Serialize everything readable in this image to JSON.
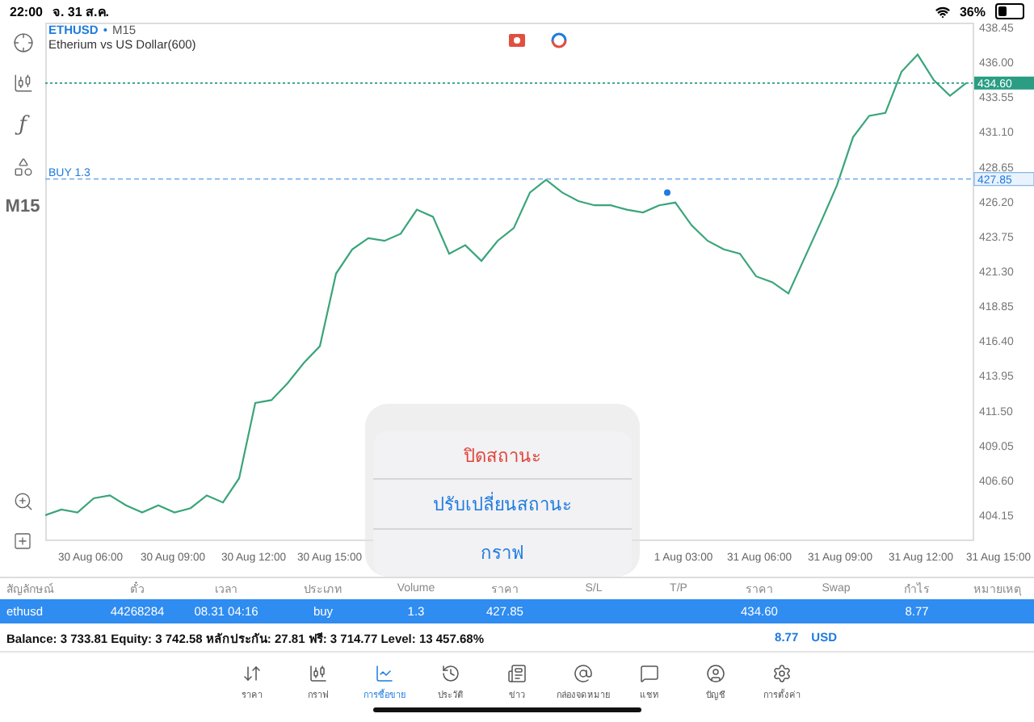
{
  "status_bar": {
    "time": "22:00",
    "date": "จ. 31 ส.ค.",
    "battery": "36%"
  },
  "left_toolbar": {
    "indicator": "ƒ",
    "timeframe": "M15"
  },
  "chart": {
    "symbol": "ETHUSD",
    "separator": "•",
    "timeframe": "M15",
    "subtitle": "Etherium vs US Dollar(600)",
    "order_label": "BUY 1.3",
    "chart_data": {
      "type": "line",
      "series": [
        {
          "color": "#3aa57a",
          "values": [
            404.2,
            404.6,
            404.4,
            405.4,
            405.6,
            404.9,
            404.4,
            404.9,
            404.4,
            404.7,
            405.6,
            405.1,
            406.8,
            412.1,
            412.3,
            413.5,
            414.9,
            416.1,
            421.2,
            422.9,
            423.7,
            423.5,
            424.0,
            425.7,
            425.2,
            422.6,
            423.2,
            422.1,
            423.5,
            424.4,
            426.9,
            427.8,
            426.9,
            426.3,
            426.0,
            426.0,
            425.7,
            425.5,
            426.0,
            426.2,
            424.6,
            423.5,
            422.9,
            422.6,
            421.0,
            420.6,
            419.8,
            422.3,
            424.8,
            427.4,
            430.8,
            432.3,
            432.5,
            435.4,
            436.6,
            434.8,
            433.7,
            434.6
          ]
        }
      ],
      "ylim": [
        402.5,
        438.85
      ],
      "yticks": [
        {
          "value": 438.45,
          "label": "438.45"
        },
        {
          "value": 436.0,
          "label": "436.00"
        },
        {
          "value": 433.55,
          "label": "433.55"
        },
        {
          "value": 431.1,
          "label": "431.10"
        },
        {
          "value": 428.65,
          "label": "428.65"
        },
        {
          "value": 426.2,
          "label": "426.20"
        },
        {
          "value": 423.75,
          "label": "423.75"
        },
        {
          "value": 421.3,
          "label": "421.30"
        },
        {
          "value": 418.85,
          "label": "418.85"
        },
        {
          "value": 416.4,
          "label": "416.40"
        },
        {
          "value": 413.95,
          "label": "413.95"
        },
        {
          "value": 411.5,
          "label": "411.50"
        },
        {
          "value": 409.05,
          "label": "409.05"
        },
        {
          "value": 406.6,
          "label": "406.60"
        },
        {
          "value": 404.15,
          "label": "404.15"
        }
      ]
    },
    "price_lines": [
      {
        "label": "434.60",
        "kind": "current"
      },
      {
        "label": "427.85",
        "kind": "order"
      }
    ],
    "time_labels": [
      "30 Aug 06:00",
      "30 Aug 09:00",
      "30 Aug 12:00",
      "30 Aug 15:00",
      "1 Aug 03:00",
      "31 Aug 06:00",
      "31 Aug 09:00",
      "31 Aug 12:00",
      "31 Aug 15:00"
    ]
  },
  "action_sheet": {
    "items": [
      {
        "label": "ปิดสถานะ",
        "kind": "destructive"
      },
      {
        "label": "ปรับเปลี่ยนสถานะ",
        "kind": "default"
      },
      {
        "label": "กราฟ",
        "kind": "default"
      }
    ]
  },
  "positions": {
    "columns": [
      "สัญลักษณ์",
      "ตั๋ว",
      "เวลา",
      "ประเภท",
      "Volume",
      "ราคา",
      "S/L",
      "T/P",
      "ราคา",
      "Swap",
      "กำไร",
      "หมายเหตุ"
    ],
    "rows": [
      {
        "selected": true,
        "cells": [
          {
            "kind": "value",
            "text": "ethusd"
          },
          {
            "kind": "value",
            "text": "44268284"
          },
          {
            "kind": "value",
            "text": "08.31 04:16"
          },
          {
            "kind": "value",
            "text": "buy"
          },
          {
            "kind": "value",
            "text": "1.3"
          },
          {
            "kind": "value",
            "text": "427.85"
          },
          {
            "kind": "empty"
          },
          {
            "kind": "empty"
          },
          {
            "kind": "value",
            "text": "434.60"
          },
          {
            "kind": "empty"
          },
          {
            "kind": "value",
            "text": "8.77"
          },
          {
            "kind": "empty"
          }
        ]
      }
    ]
  },
  "summary": {
    "text": "Balance: 3 733.81 Equity: 3 742.58 หลักประกัน: 27.81 ฟรี: 3 714.77 Level: 13 457.68%",
    "profit": "8.77",
    "currency": "USD"
  },
  "tab_bar": [
    {
      "label": "ราคา",
      "kind": "quotes",
      "selected": false
    },
    {
      "label": "กราฟ",
      "kind": "chart",
      "selected": false
    },
    {
      "label": "การซื้อขาย",
      "kind": "trade",
      "selected": true
    },
    {
      "label": "ประวัติ",
      "kind": "history",
      "selected": false
    },
    {
      "label": "ข่าว",
      "kind": "news",
      "selected": false
    },
    {
      "label": "กล่องจดหมาย",
      "kind": "mail",
      "selected": false
    },
    {
      "label": "แชท",
      "kind": "chat",
      "selected": false
    },
    {
      "label": "บัญชี",
      "kind": "account",
      "selected": false
    },
    {
      "label": "การตั้งค่า",
      "kind": "settings",
      "selected": false
    }
  ]
}
